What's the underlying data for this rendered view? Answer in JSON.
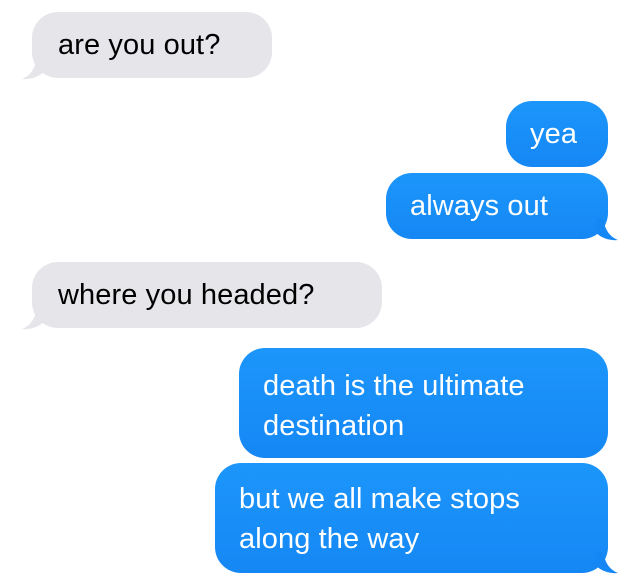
{
  "conversation": {
    "messages": [
      {
        "sender": "them",
        "text": "are you out?"
      },
      {
        "sender": "me",
        "text": "yea"
      },
      {
        "sender": "me",
        "text": "always out"
      },
      {
        "sender": "them",
        "text": "where you headed?"
      },
      {
        "sender": "me",
        "text": "death is the ultimate destination",
        "lines": [
          "death is the ultimate",
          "destination"
        ]
      },
      {
        "sender": "me",
        "text": "but we all make stops along the way",
        "lines": [
          "but we all make stops",
          "along the way"
        ]
      }
    ]
  },
  "colors": {
    "incoming_bubble": "#e5e5ea",
    "incoming_text": "#000000",
    "outgoing_bubble": "#1a8cf8",
    "outgoing_text": "#ffffff",
    "background": "#ffffff"
  }
}
